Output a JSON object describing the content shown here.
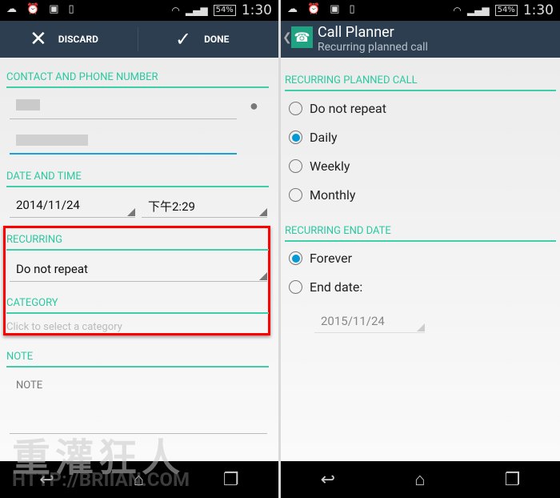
{
  "status": {
    "time": "1:30",
    "battery": "54%"
  },
  "left": {
    "discard_label": "DISCARD",
    "done_label": "DONE",
    "contact_section": "CONTACT AND PHONE NUMBER",
    "date_section": "DATE AND TIME",
    "date": "2014/11/24",
    "time": "下午2:29",
    "recurring_section": "RECURRING",
    "recurring_value": "Do not repeat",
    "category_section": "CATEGORY",
    "category_placeholder": "Click to select a category",
    "note_section": "NOTE",
    "note_placeholder": "NOTE"
  },
  "right": {
    "title": "Call Planner",
    "subtitle": "Recurring planned call",
    "recurring_section": "RECURRING PLANNED CALL",
    "options": [
      {
        "label": "Do not repeat",
        "selected": false
      },
      {
        "label": "Daily",
        "selected": true
      },
      {
        "label": "Weekly",
        "selected": false
      },
      {
        "label": "Monthly",
        "selected": false
      }
    ],
    "end_section": "RECURRING END DATE",
    "end_options": [
      {
        "label": "Forever",
        "selected": true
      },
      {
        "label": "End date:",
        "selected": false
      }
    ],
    "end_date": "2015/11/24"
  },
  "watermark": {
    "chars": "重灌狂人",
    "url": "HTTP://BRIIAN.COM"
  },
  "colors": {
    "accent": "#2bc8a0",
    "actionbar": "#2c3e50",
    "radio": "#0399d4",
    "highlight": "#ff0000"
  }
}
